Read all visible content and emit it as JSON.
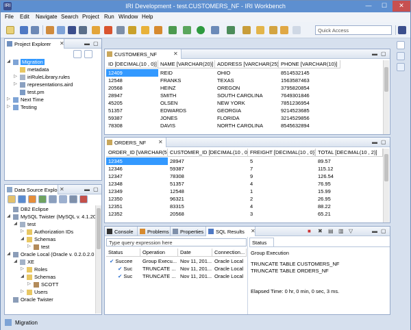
{
  "window": {
    "title": "IRI Development - test.CUSTOMERS_NF - IRI Workbench",
    "minimize": "—",
    "maximize": "☐",
    "close": "✕",
    "app_icon_text": "IRI"
  },
  "menu": [
    "File",
    "Edit",
    "Navigate",
    "Search",
    "Project",
    "Run",
    "Window",
    "Help"
  ],
  "toolbar": {
    "quick_access_placeholder": "Quick Access"
  },
  "project_explorer": {
    "tab_label": "Project Explorer",
    "items": [
      {
        "label": "Migration",
        "selected": true
      },
      {
        "label": "metadata"
      },
      {
        "label": "iriRuleLibrary.rules"
      },
      {
        "label": "representations.aird"
      },
      {
        "label": "test.pm"
      },
      {
        "label": "Next Time"
      },
      {
        "label": "Testing"
      }
    ]
  },
  "data_source_explorer": {
    "tab_label": "Data Source Explo",
    "items": [
      {
        "label": "DB2 Eclipse"
      },
      {
        "label": "MySQL Twister (MySQL v. 4.1.20"
      },
      {
        "label": "test"
      },
      {
        "label": "Authorization IDs"
      },
      {
        "label": "Schemas"
      },
      {
        "label": "test"
      },
      {
        "label": "Oracle Local (Oracle v. 0.2.0.2.0 -"
      },
      {
        "label": "XE"
      },
      {
        "label": "Roles"
      },
      {
        "label": "Schemas"
      },
      {
        "label": "SCOTT"
      },
      {
        "label": "Users"
      },
      {
        "label": "Oracle Twister"
      }
    ]
  },
  "customers": {
    "tab_label": "CUSTOMERS_NF",
    "columns": [
      "ID [DECIMAL(10 , 0)]",
      "NAME [VARCHAR(20)]",
      "ADDRESS [VARCHAR(25)]",
      "PHONE [VARCHAR(10)]"
    ],
    "rows": [
      [
        "12409",
        "REID",
        "OHIO",
        "8514532145"
      ],
      [
        "12548",
        "FRANKS",
        "TEXAS",
        "1563587463"
      ],
      [
        "20568",
        "HEINZ",
        "OREGON",
        "3795820854"
      ],
      [
        "28947",
        "SMITH",
        "SOUTH CAROLINA",
        "7649301846"
      ],
      [
        "45205",
        "OLSEN",
        "NEW YORK",
        "7851236954"
      ],
      [
        "51357",
        "EDWARDS",
        "GEORGIA",
        "9214523685"
      ],
      [
        "59387",
        "JONES",
        "FLORIDA",
        "3214529856"
      ],
      [
        "78308",
        "DAVIS",
        "NORTH CAROLINA",
        "8545632894"
      ]
    ]
  },
  "orders": {
    "tab_label": "ORDERS_NF",
    "columns": [
      "ORDER_ID [VARCHAR(5)]",
      "CUSTOMER_ID [DECIMAL(10 , 0)]",
      "FREIGHT [DECIMAL(10 , 0)]",
      "TOTAL [DECIMAL(10 , 2)]"
    ],
    "rows": [
      [
        "12345",
        "28947",
        "5",
        "89.57"
      ],
      [
        "12346",
        "59387",
        "7",
        "115.12"
      ],
      [
        "12347",
        "78308",
        "9",
        "126.54"
      ],
      [
        "12348",
        "51357",
        "4",
        "76.95"
      ],
      [
        "12349",
        "12548",
        "1",
        "15.99"
      ],
      [
        "12350",
        "96321",
        "2",
        "26.95"
      ],
      [
        "12351",
        "83315",
        "4",
        "88.22"
      ],
      [
        "12352",
        "20568",
        "3",
        "65.21"
      ]
    ]
  },
  "bottom_tabs": [
    "Console",
    "Problems",
    "Properties",
    "SQL Results"
  ],
  "sql_results": {
    "filter_placeholder": "Type query expression here",
    "columns": [
      "Status",
      "Operation",
      "Date",
      "Connection..."
    ],
    "rows": [
      {
        "status": "Succee",
        "operation": "Group Execu...",
        "date": "Nov 11, 201...",
        "connection": "Oracle Local"
      },
      {
        "status": "Suc",
        "operation": "TRUNCATE ...",
        "date": "Nov 11, 201...",
        "connection": "Oracle Local"
      },
      {
        "status": "Suc",
        "operation": "TRUNCATE ...",
        "date": "Nov 11, 201...",
        "connection": "Oracle Local"
      }
    ],
    "status_tab": "Status",
    "status_title": "Group Execution",
    "status_lines": [
      "TRUNCATE TABLE CUSTOMERS_NF",
      "TRUNCATE TABLE ORDERS_NF"
    ],
    "elapsed": "Elapsed Time:  0 hr, 0 min, 0 sec, 3 ms."
  },
  "statusbar": {
    "label": "Migration"
  }
}
